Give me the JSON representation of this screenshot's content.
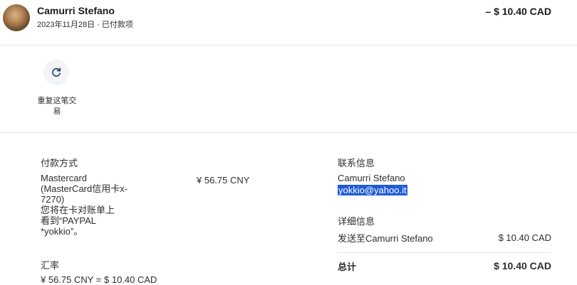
{
  "header": {
    "name": "Camurri Stefano",
    "date": "2023年11月28日",
    "separator": "·",
    "status": "已付款项",
    "amount": "– $ 10.40 CAD"
  },
  "actions": {
    "repeat_label": "重复这笔交易",
    "repeat_icon": "refresh-icon"
  },
  "payment": {
    "title": "付款方式",
    "card_lines": [
      "Mastercard",
      "(MasterCard信用卡x-",
      "7270)",
      "您将在卡对账单上",
      "看到“PAYPAL",
      "*yokkio”。"
    ],
    "amount": "¥ 56.75 CNY"
  },
  "exchange": {
    "title": "汇率",
    "value": "¥ 56.75 CNY = $ 10.40 CAD"
  },
  "contact": {
    "title": "联系信息",
    "name": "Camurri Stefano",
    "email": "yokkio@yahoo.it"
  },
  "details": {
    "title": "详细信息",
    "label": "发送至Camurri Stefano",
    "amount": "$ 10.40 CAD"
  },
  "total": {
    "label": "总计",
    "amount": "$ 10.40 CAD"
  },
  "colors": {
    "accent": "#1f5bd6",
    "text": "#2c2e2f",
    "divider": "#e6e6e6"
  }
}
